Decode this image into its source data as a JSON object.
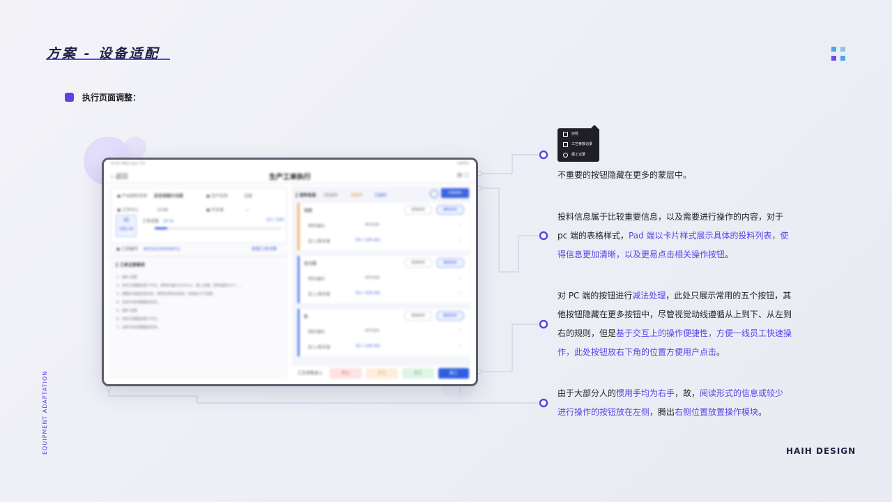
{
  "header": {
    "title": "方案 - 设备适配"
  },
  "section": {
    "label": "执行页面调整："
  },
  "side_label": "EQUIPMENT ADAPTATION",
  "footer_brand": "HAIH DESIGN",
  "colors": {
    "accent": "#5b43e6",
    "brand_dot_blue": "#4fa6e0",
    "brand_dot_purple": "#6b4ee6"
  },
  "popup_menu": {
    "items": [
      {
        "icon": "comment-icon",
        "label": "还检"
      },
      {
        "icon": "document-icon",
        "label": "工艺参数记录"
      },
      {
        "icon": "clock-icon",
        "label": "报工记录"
      }
    ]
  },
  "annotations": [
    {
      "parts": [
        {
          "text": "不重要的按钮隐藏在更多的蒙层中。",
          "highlight": false
        }
      ]
    },
    {
      "parts": [
        {
          "text": "投料信息属于比较重要信息，以及需要进行操作的内容，对于pc 端的表格样式，",
          "highlight": false
        },
        {
          "text": "Pad 端以卡片样式展示具体的投料列表，使得信息更加清晰，以及更易点击相关操作按钮",
          "highlight": true
        },
        {
          "text": "。",
          "highlight": false
        }
      ]
    },
    {
      "parts": [
        {
          "text": "对 PC 端的按钮进行",
          "highlight": false
        },
        {
          "text": "减法处理",
          "highlight": true
        },
        {
          "text": "，此处只展示常用的五个按钮，其他按钮隐藏在更多按钮中，尽管视觉动线遵循从上到下、从左到右的规则，但是",
          "highlight": false
        },
        {
          "text": "基于交互上的操作便捷性，方便一线员工快速操作，此处按钮放右下角的位置方便用户点击",
          "highlight": true
        },
        {
          "text": "。",
          "highlight": false
        }
      ]
    },
    {
      "parts": [
        {
          "text": "由于大部分人的",
          "highlight": false
        },
        {
          "text": "惯用手均为右手",
          "highlight": true
        },
        {
          "text": "，故，",
          "highlight": false
        },
        {
          "text": "阅读形式的信息或较少进行操作的按钮放在左侧",
          "highlight": true
        },
        {
          "text": "，腾出",
          "highlight": false
        },
        {
          "text": "右侧位置放置操作模块",
          "highlight": true
        },
        {
          "text": "。",
          "highlight": false
        }
      ]
    }
  ],
  "device_screen": {
    "status_left": "9:41  Mon Jun 10",
    "status_right": "100%",
    "back_label": "返回",
    "page_title": "生产工单执行",
    "left_info": [
      {
        "label": "产出物料名称",
        "value": "某某钢圈外协圈"
      },
      {
        "label": "生产任务",
        "value": "注胶"
      },
      {
        "label": "工作中心",
        "value": "ST48"
      },
      {
        "label": "作业者",
        "value": "—"
      }
    ],
    "progress_label": "工单进度",
    "progress_value": "10 %",
    "progress_count": "10 / 100",
    "progress_fraction": 0.1,
    "switch_label": "切换工单",
    "order_no_label": "工单编号",
    "order_no_value": "WO20230406413",
    "order_detail_link": "查看工单详情",
    "notes_title": "工单注意事项",
    "notes_lines": [
      "1、装料·送量",
      "2、将定位钢圈放置于平台，保持炉温约为30min，插入定器，控制温度10℃，...",
      "3、钢圈外表面检查状态，保持拉伸状态良好，用游标卡尺测量...",
      "4、采用专用测量器具检测...",
      "5、装料·送量",
      "6、将定位钢圈放置于平台...",
      "7、采用专用测量器具检测..."
    ],
    "right_tab": "投料信息",
    "right_tags": [
      "1条投料",
      "待投料",
      "已投料"
    ],
    "right_action": "扫码投料",
    "feed_cards": [
      {
        "name": "钢圈",
        "code_label": "物料编码",
        "code": "MY006",
        "qty_label": "投入/需求量",
        "qty": "50 / 100 KG",
        "btn1": "查看投料",
        "btn2": "重新投料"
      },
      {
        "name": "定位圈",
        "code_label": "物料编码",
        "code": "MY008",
        "qty_label": "投入/需求量",
        "qty": "50 / 100 KG",
        "btn1": "查看投料",
        "btn2": "重新投料"
      },
      {
        "name": "胶",
        "code_label": "物料编码",
        "code": "MY009",
        "qty_label": "投入/需求量",
        "qty": "50 / 100 KG",
        "btn1": "查看投料",
        "btn2": "重新投料"
      }
    ],
    "action_bar": {
      "more": "工艺参数录入",
      "pause": "停止",
      "start": "开工",
      "finish": "完工",
      "report": "报工"
    }
  }
}
